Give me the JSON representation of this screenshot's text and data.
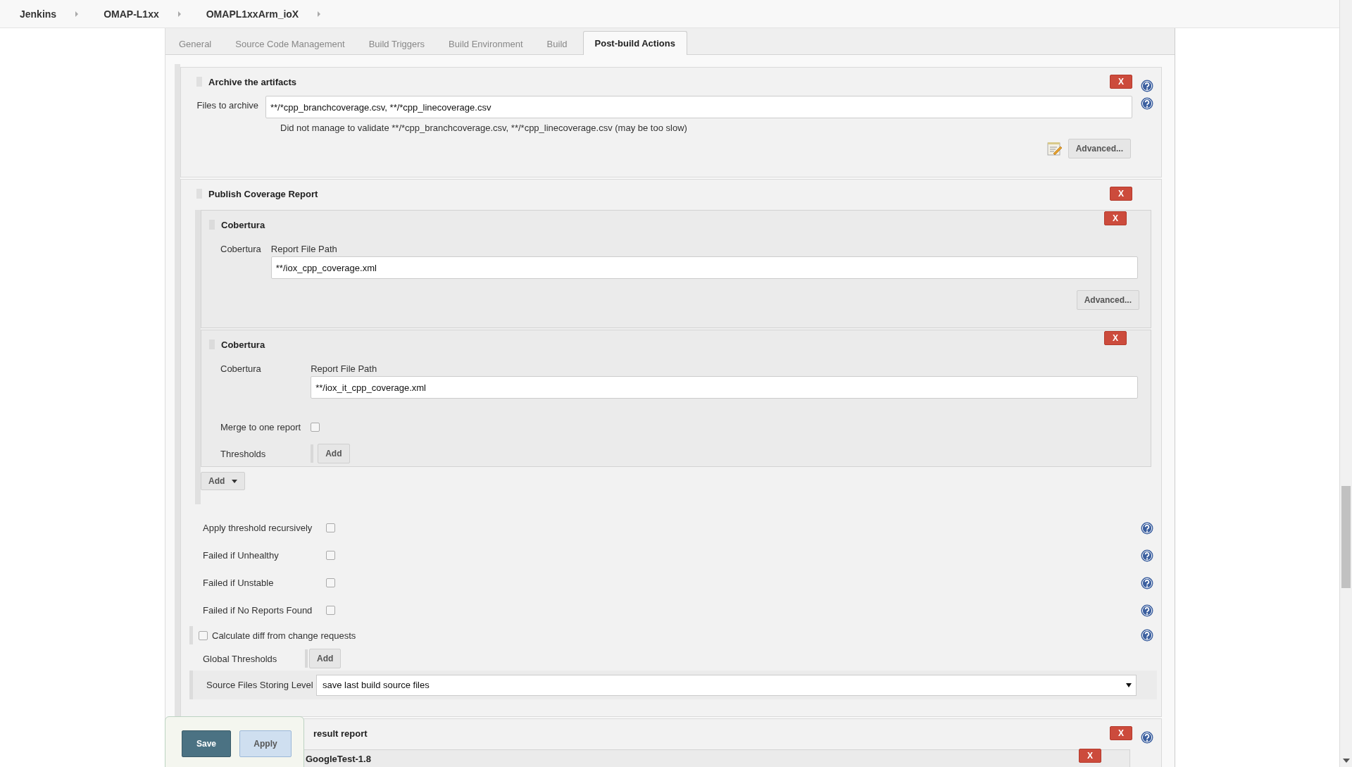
{
  "breadcrumbs": [
    "Jenkins",
    "OMAP-L1xx",
    "OMAPL1xxArm_ioX"
  ],
  "tabs": [
    {
      "label": "General",
      "selected": false
    },
    {
      "label": "Source Code Management",
      "selected": false
    },
    {
      "label": "Build Triggers",
      "selected": false
    },
    {
      "label": "Build Environment",
      "selected": false
    },
    {
      "label": "Build",
      "selected": false
    },
    {
      "label": "Post-build Actions",
      "selected": true
    }
  ],
  "archive": {
    "title": "Archive the artifacts",
    "delete": "X",
    "field_label": "Files to archive",
    "value": "**/*cpp_branchcoverage.csv, **/*cpp_linecoverage.csv",
    "warning": "Did not manage to validate **/*cpp_branchcoverage.csv, **/*cpp_linecoverage.csv (may be too slow)",
    "advanced": "Advanced..."
  },
  "coverage": {
    "title": "Publish Coverage Report",
    "delete": "X",
    "adapters": [
      {
        "title": "Cobertura",
        "delete": "X",
        "label": "Cobertura",
        "field_label": "Report File Path",
        "value": "**/iox_cpp_coverage.xml",
        "advanced": "Advanced..."
      },
      {
        "title": "Cobertura",
        "delete": "X",
        "label": "Cobertura",
        "field_label": "Report File Path",
        "value": "**/iox_it_cpp_coverage.xml",
        "merge": {
          "label": "Merge to one report",
          "checked": false
        },
        "thresholds": {
          "label": "Thresholds",
          "button": "Add"
        }
      }
    ],
    "add_button": "Add",
    "options": [
      {
        "label": "Apply threshold recursively",
        "checked": false
      },
      {
        "label": "Failed if Unhealthy",
        "checked": false
      },
      {
        "label": "Failed if Unstable",
        "checked": false
      },
      {
        "label": "Failed if No Reports Found",
        "checked": false
      }
    ],
    "diff": {
      "label": "Calculate diff from change requests",
      "checked": false
    },
    "global_thresholds": {
      "label": "Global Thresholds",
      "button": "Add"
    },
    "storing_level": {
      "label": "Source Files Storing Level",
      "value": "save last build source files"
    }
  },
  "result_section": {
    "title": "result report",
    "delete": "X",
    "inner": {
      "title": "GoogleTest-1.8",
      "delete": "X"
    }
  },
  "actions": {
    "save": "Save",
    "apply": "Apply"
  }
}
